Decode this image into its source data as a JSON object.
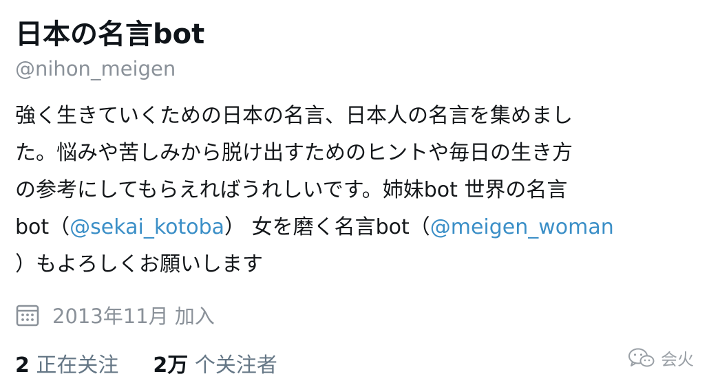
{
  "profile": {
    "display_name": "日本の名言bot",
    "handle": "@nihon_meigen",
    "bio": {
      "line1": "強く生きていくための日本の名言、日本人の名言を集めまし",
      "line2": "た。悩みや苦しみから脱け出すためのヒントや毎日の生き方",
      "line3": "の参考にしてもらえればうれしいです。姉妹bot 世界の名言",
      "line4_prefix": "bot（",
      "mention1": "@sekai_kotoba",
      "line4_middle": "） 女を磨く名言bot（",
      "mention2": "@meigen_woman",
      "line5": "）もよろしくお願いします"
    },
    "joined": "2013年11月 加入",
    "stats": {
      "following_count": "2",
      "following_label": "正在关注",
      "followers_count": "2万",
      "followers_unit": "个",
      "followers_label": "关注者"
    }
  },
  "watermark": {
    "text": "会火"
  },
  "icons": {
    "calendar": "calendar-icon",
    "wechat": "wechat-icon"
  }
}
